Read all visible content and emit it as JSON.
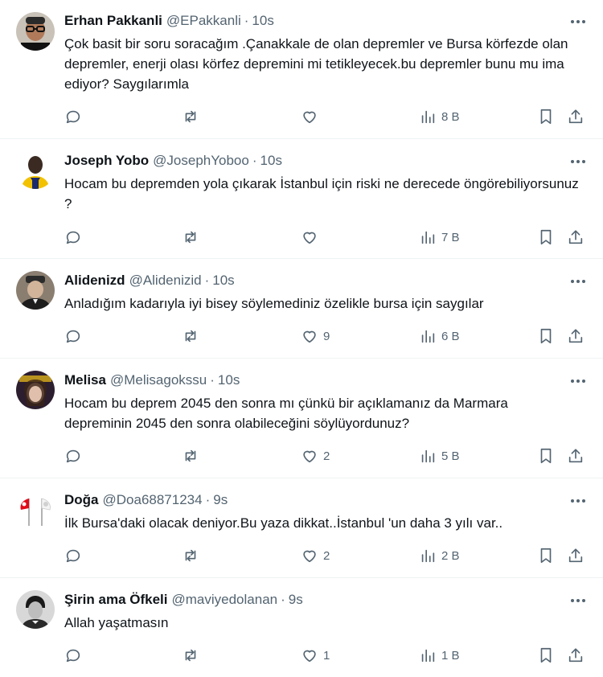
{
  "tweets": [
    {
      "name": "Erhan Pakkanli",
      "handle": "@EPakkanli",
      "time": "10s",
      "text": "Çok basit bir soru soracağım .Çanakkale de olan depremler ve Bursa körfezde olan depremler, enerji  olası körfez depremini mi tetikleyecek.bu depremler bunu mu ima ediyor? Saygılarımla",
      "likes": "",
      "views": "8 B",
      "avatar": "man-glasses-avatar"
    },
    {
      "name": "Joseph Yobo",
      "handle": "@JosephYoboo",
      "time": "10s",
      "text": "Hocam bu depremden yola çıkarak İstanbul için riski ne derecede öngörebiliyorsunuz ?",
      "likes": "",
      "views": "7 B",
      "avatar": "footballer-avatar"
    },
    {
      "name": "Alidenizd",
      "handle": "@Alidenizid",
      "time": "10s",
      "text": "Anladığım kadarıyla iyi bisey söylemediniz özelikle bursa için saygılar",
      "likes": "9",
      "views": "6 B",
      "avatar": "portrait-avatar"
    },
    {
      "name": "Melisa",
      "handle": "@Melisagokssu",
      "time": "10s",
      "text": "Hocam bu deprem 2045 den sonra mı çünkü bir açıklamanız da Marmara depreminin 2045 den sonra olabileceğini söylüyordunuz?",
      "likes": "2",
      "views": "5 B",
      "avatar": "album-cover-avatar"
    },
    {
      "name": "Doğa",
      "handle": "@Doa68871234",
      "time": "9s",
      "text": "İlk Bursa'daki olacak deniyor.Bu yaza dikkat..İstanbul 'un daha 3 yılı var..",
      "likes": "2",
      "views": "2 B",
      "avatar": "flags-avatar"
    },
    {
      "name": "Şirin ama Öfkeli",
      "handle": "@maviyedolanan",
      "time": "9s",
      "text": "Allah yaşatmasın",
      "likes": "1",
      "views": "1 B",
      "avatar": "vintage-portrait-avatar"
    }
  ],
  "colors": {
    "text": "#0f1419",
    "muted": "#536471",
    "divider": "#eff3f4"
  }
}
